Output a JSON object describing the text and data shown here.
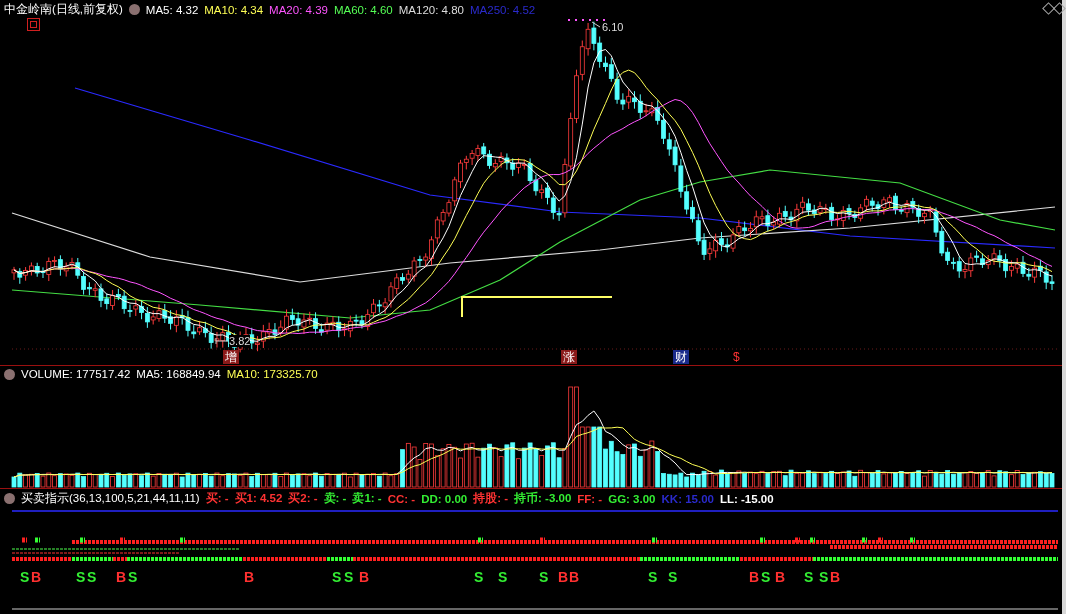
{
  "price_panel": {
    "title": "中金岭南(日线,前复权)",
    "indicators": [
      {
        "label": "MA5: 4.32",
        "color": "#ffffff"
      },
      {
        "label": "MA10: 4.34",
        "color": "#ffff55"
      },
      {
        "label": "MA20: 4.39",
        "color": "#ff55ff"
      },
      {
        "label": "MA60: 4.60",
        "color": "#55ff55"
      },
      {
        "label": "MA120: 4.80",
        "color": "#dddddd"
      },
      {
        "label": "MA250: 4.52",
        "color": "#2a2acc"
      }
    ],
    "high_label": "6.10",
    "low_label": "3.82",
    "markers": [
      {
        "text": "增",
        "color": "#8b1a1a",
        "kind": "badge"
      },
      {
        "text": "涨",
        "color": "#8b1a1a",
        "kind": "badge"
      },
      {
        "text": "财",
        "color": "#1a2a8b",
        "kind": "badge"
      },
      {
        "text": "$",
        "color": "#ff3333",
        "kind": "plain"
      }
    ]
  },
  "volume_panel": {
    "readings": [
      {
        "label": "VOLUME: 177517.42",
        "color": "#ffffff"
      },
      {
        "label": "MA5: 168849.94",
        "color": "#ffffff"
      },
      {
        "label": "MA10: 173325.70",
        "color": "#ffff55"
      }
    ]
  },
  "signal_panel": {
    "title": "买卖指示(36,13,100,5,21,44,11,11)",
    "readings": [
      {
        "label": "买: -",
        "color": "#ff3333"
      },
      {
        "label": "买1: 4.52",
        "color": "#ff3333"
      },
      {
        "label": "买2: -",
        "color": "#ff3333"
      },
      {
        "label": "卖: -",
        "color": "#33ee33"
      },
      {
        "label": "卖1: -",
        "color": "#33ee33"
      },
      {
        "label": "CC: -",
        "color": "#ff3333"
      },
      {
        "label": "DD: 0.00",
        "color": "#33ee33"
      },
      {
        "label": "持股: -",
        "color": "#ff3333"
      },
      {
        "label": "持币: -3.00",
        "color": "#33ee33"
      },
      {
        "label": "FF: -",
        "color": "#ff3333"
      },
      {
        "label": "GG: 3.00",
        "color": "#33ee33"
      },
      {
        "label": "KK: 15.00",
        "color": "#2a2acc"
      },
      {
        "label": "LL: -15.00",
        "color": "#ffffff"
      }
    ],
    "signals": [
      {
        "text": "S",
        "kind": "sell"
      },
      {
        "text": "B",
        "kind": "buy"
      },
      {
        "text": "S",
        "kind": "sell"
      },
      {
        "text": "S",
        "kind": "sell"
      },
      {
        "text": "B",
        "kind": "buy"
      },
      {
        "text": "S",
        "kind": "sell"
      },
      {
        "text": "B",
        "kind": "buy"
      },
      {
        "text": "S",
        "kind": "sell"
      },
      {
        "text": "S",
        "kind": "sell"
      },
      {
        "text": "B",
        "kind": "buy"
      },
      {
        "text": "S",
        "kind": "sell"
      },
      {
        "text": "S",
        "kind": "sell"
      },
      {
        "text": "S",
        "kind": "sell"
      },
      {
        "text": "B",
        "kind": "buy"
      },
      {
        "text": "B",
        "kind": "buy"
      },
      {
        "text": "S",
        "kind": "sell"
      },
      {
        "text": "S",
        "kind": "sell"
      },
      {
        "text": "B",
        "kind": "buy"
      },
      {
        "text": "S",
        "kind": "sell"
      },
      {
        "text": "B",
        "kind": "buy"
      },
      {
        "text": "S",
        "kind": "sell"
      },
      {
        "text": "S",
        "kind": "sell"
      },
      {
        "text": "B",
        "kind": "buy"
      }
    ]
  }
}
